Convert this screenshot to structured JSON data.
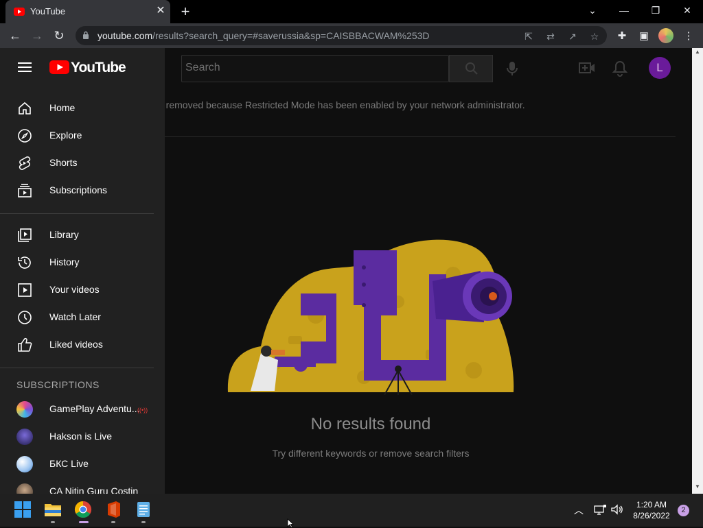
{
  "browser": {
    "tab_title": "YouTube",
    "url_host": "youtube.com",
    "url_path": "/results?search_query=#saverussia&sp=CAISBBACWAM%253D",
    "window_buttons": {
      "minimize": "—",
      "restore": "❐",
      "close": "✕",
      "tab_list": "⌄"
    },
    "nav": {
      "back": "←",
      "forward": "→",
      "reload": "↻"
    },
    "new_tab": "+",
    "tab_close": "✕"
  },
  "header": {
    "search_placeholder": "Search",
    "user_initial": "L"
  },
  "main": {
    "restricted_message": "n removed because Restricted Mode has been enabled by your network administrator.",
    "no_results_title": "No results found",
    "no_results_subtitle": "Try different keywords or remove search filters"
  },
  "drawer": {
    "logo_text": "YouTube",
    "primary_items": [
      {
        "label": "Home",
        "icon": "home-icon"
      },
      {
        "label": "Explore",
        "icon": "compass-icon"
      },
      {
        "label": "Shorts",
        "icon": "shorts-icon"
      },
      {
        "label": "Subscriptions",
        "icon": "subscriptions-icon"
      }
    ],
    "secondary_items": [
      {
        "label": "Library",
        "icon": "library-icon"
      },
      {
        "label": "History",
        "icon": "history-icon"
      },
      {
        "label": "Your videos",
        "icon": "your-videos-icon"
      },
      {
        "label": "Watch Later",
        "icon": "clock-icon"
      },
      {
        "label": "Liked videos",
        "icon": "thumbs-up-icon"
      }
    ],
    "subscriptions_heading": "SUBSCRIPTIONS",
    "subscriptions": [
      {
        "label": "GamePlay Adventu...",
        "live": true
      },
      {
        "label": "Hakson is Live"
      },
      {
        "label": "БКС Live"
      },
      {
        "label": "CA Nitin Guru Costin"
      }
    ]
  },
  "taskbar": {
    "time": "1:20 AM",
    "date": "8/26/2022",
    "notification_count": "2",
    "apps": [
      "start-icon",
      "file-explorer-icon",
      "chrome-icon",
      "office-icon",
      "notepad-icon"
    ]
  },
  "colors": {
    "yt_red": "#ff0000",
    "drawer_bg": "#212121",
    "page_bg": "#0f0f0f",
    "illustration_yellow": "#c9a21c",
    "illustration_purple": "#5b2ca0"
  }
}
